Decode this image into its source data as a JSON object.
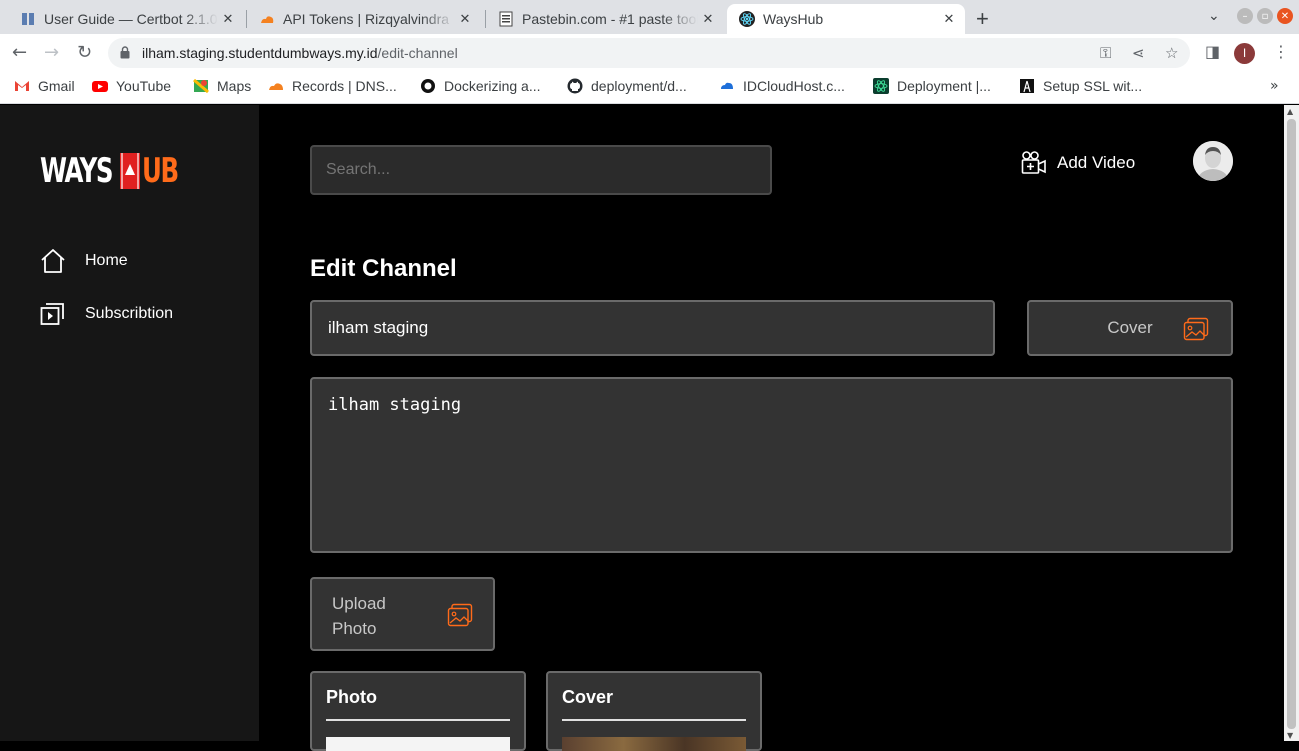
{
  "browser": {
    "tabs": [
      {
        "title": "User Guide — Certbot 2.1.0",
        "icon": "book-icon"
      },
      {
        "title": "API Tokens | Rizqyalvindra",
        "icon": "cloudflare-icon"
      },
      {
        "title": "Pastebin.com - #1 paste tool",
        "icon": "pastebin-icon"
      },
      {
        "title": "WaysHub",
        "icon": "react-icon",
        "active": true
      }
    ],
    "url_host": "ilham.staging.studentdumbways.my.id",
    "url_path": "/edit-channel",
    "profile_initial": "I",
    "bookmarks": [
      {
        "label": "Gmail",
        "icon": "gmail-icon"
      },
      {
        "label": "YouTube",
        "icon": "youtube-icon"
      },
      {
        "label": "Maps",
        "icon": "maps-icon"
      },
      {
        "label": "Records | DNS...",
        "icon": "cloudflare-icon"
      },
      {
        "label": "Dockerizing a...",
        "icon": "circle-icon"
      },
      {
        "label": "deployment/d...",
        "icon": "github-icon"
      },
      {
        "label": "IDCloudHost.c...",
        "icon": "cloud-icon"
      },
      {
        "label": "Deployment |...",
        "icon": "react-icon"
      },
      {
        "label": "Setup SSL wit...",
        "icon": "tower-icon"
      }
    ]
  },
  "app": {
    "logo_left": "WAYS",
    "logo_right": "UB",
    "brand_color": "#ff6b1a",
    "nav": [
      {
        "label": "Home",
        "icon": "home-icon"
      },
      {
        "label": "Subscribtion",
        "icon": "subscription-icon"
      }
    ],
    "search_placeholder": "Search...",
    "add_video_label": "Add Video",
    "page_title": "Edit Channel",
    "channel_name": "ilham staging",
    "cover_label": "Cover",
    "description": "ilham staging",
    "upload_photo_label": "Upload Photo",
    "previews": [
      {
        "title": "Photo"
      },
      {
        "title": "Cover"
      }
    ]
  }
}
